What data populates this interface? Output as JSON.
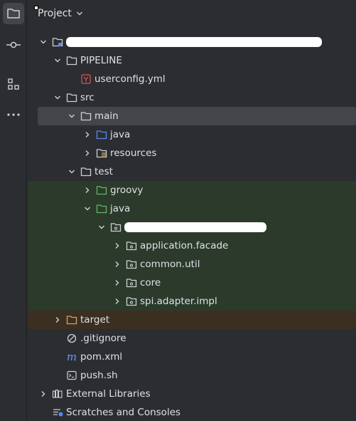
{
  "activity_bar": {
    "items": [
      {
        "name": "project",
        "icon": "folder-icon",
        "active": true
      },
      {
        "name": "commit",
        "icon": "commit-icon",
        "active": false
      },
      {
        "name": "structure",
        "icon": "structure-icon",
        "active": false
      },
      {
        "name": "more",
        "icon": "more-icon",
        "active": false
      }
    ]
  },
  "header": {
    "title": "Project"
  },
  "tree": {
    "pipeline": "PIPELINE",
    "userconfig": "userconfig.yml",
    "src": "src",
    "main": "main",
    "main_java": "java",
    "resources": "resources",
    "test": "test",
    "groovy": "groovy",
    "test_java": "java",
    "pkg_application": "application.facade",
    "pkg_common": "common.util",
    "pkg_core": "core",
    "pkg_spi": "spi.adapter.impl",
    "target": "target",
    "gitignore": ".gitignore",
    "pom": "pom.xml",
    "push": "push.sh",
    "external_libraries": "External Libraries",
    "scratches": "Scratches and Consoles"
  },
  "colors": {
    "background": "#2b2d30",
    "selected_row": "#43454a",
    "test_scope": "#2b3a2b",
    "excluded_scope": "#3b2f22",
    "folder_gray": "#ced0d6",
    "source_folder_blue": "#548af7",
    "test_folder_green": "#5fb865",
    "target_orange": "#d6a16c",
    "yaml_red": "#e05555",
    "maven_blue": "#6b9bfa"
  }
}
